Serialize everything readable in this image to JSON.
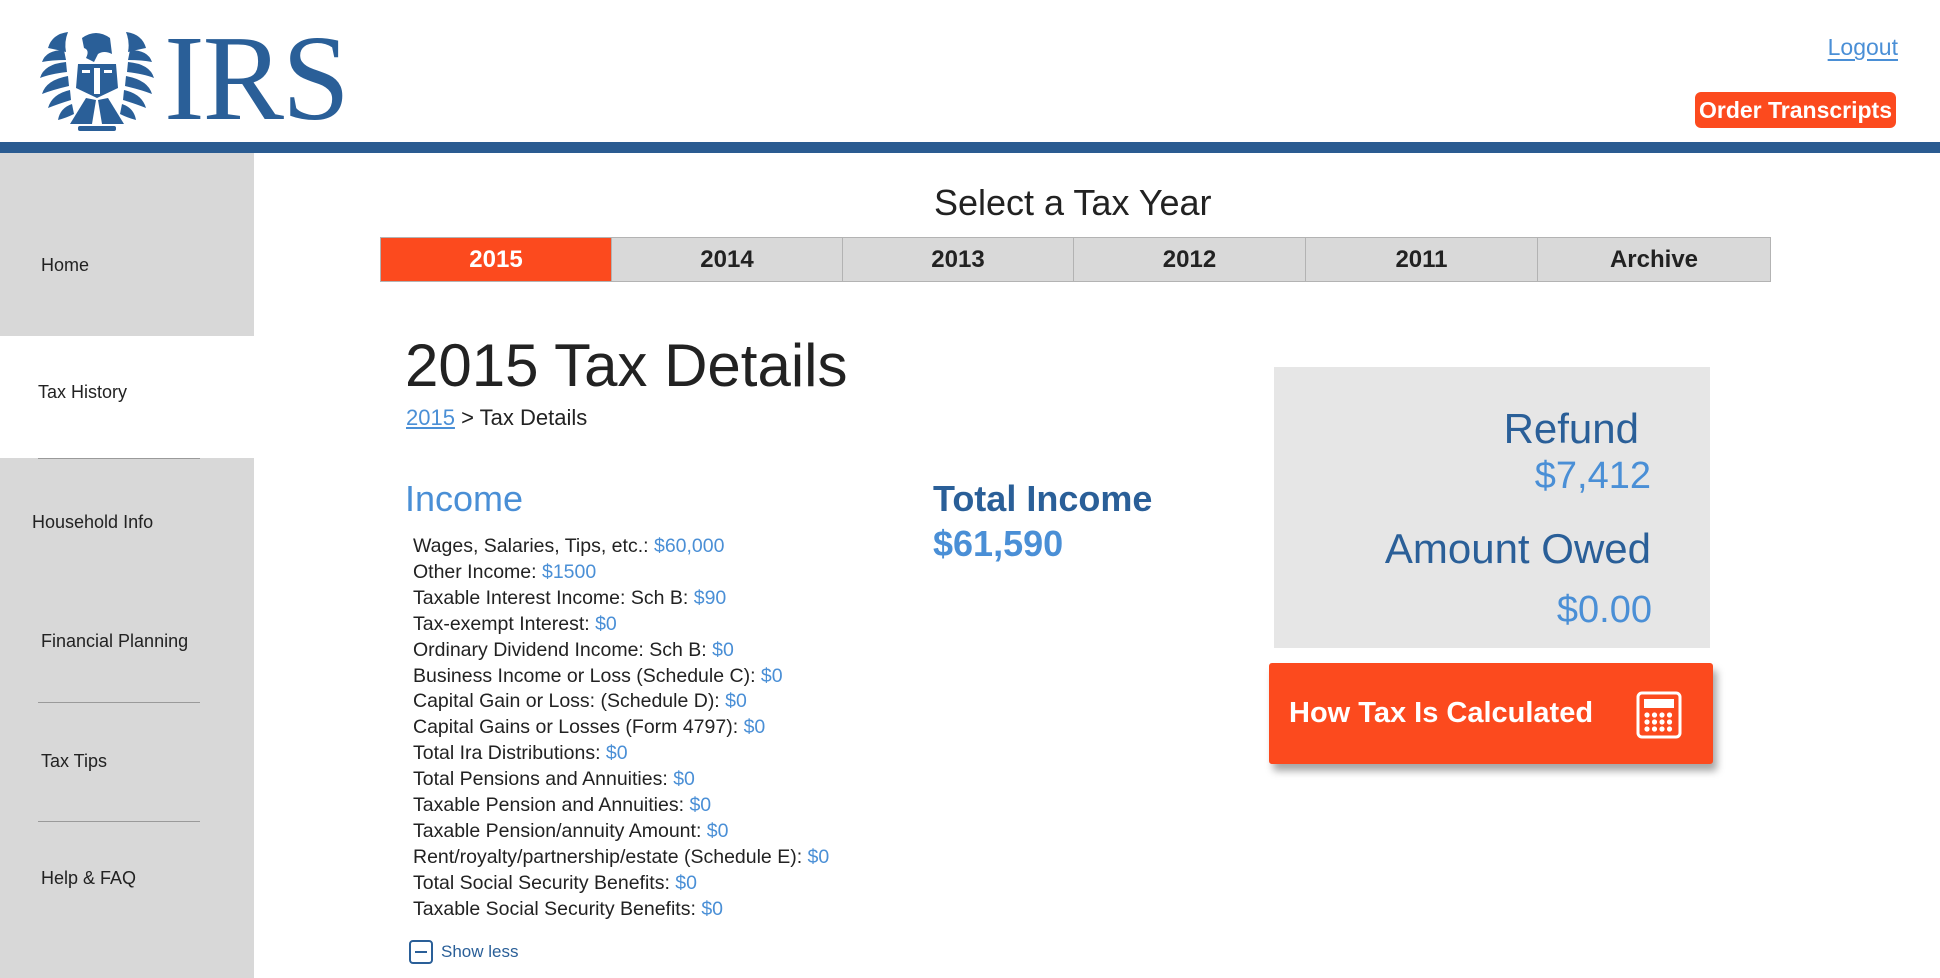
{
  "header": {
    "logo_text": "IRS",
    "logout_label": "Logout",
    "order_label": "Order Transcripts",
    "accent_color": "#fc4a1e",
    "brand_color": "#2a5b91"
  },
  "sidebar": {
    "items": [
      {
        "label": "Home",
        "active": false
      },
      {
        "label": "Tax History",
        "active": true
      },
      {
        "label": "Household Info",
        "active": false
      },
      {
        "label": "Financial Planning",
        "active": false
      },
      {
        "label": "Tax Tips",
        "active": false
      },
      {
        "label": "Help & FAQ",
        "active": false
      }
    ]
  },
  "year_select": {
    "title": "Select a Tax Year",
    "tabs": [
      {
        "label": "2015",
        "active": true
      },
      {
        "label": "2014",
        "active": false
      },
      {
        "label": "2013",
        "active": false
      },
      {
        "label": "2012",
        "active": false
      },
      {
        "label": "2011",
        "active": false
      },
      {
        "label": "Archive",
        "active": false
      }
    ]
  },
  "main": {
    "title": "2015 Tax Details",
    "breadcrumb": {
      "link": "2015",
      "separator": ">",
      "current": "Tax Details"
    },
    "income": {
      "heading": "Income",
      "rows": [
        {
          "label": "Wages, Salaries, Tips, etc.:",
          "value": "$60,000"
        },
        {
          "label": "Other Income:",
          "value": "$1500"
        },
        {
          "label": "Taxable Interest Income: Sch B:",
          "value": "$90"
        },
        {
          "label": "Tax-exempt Interest:",
          "value": "$0"
        },
        {
          "label": "Ordinary Dividend Income: Sch B:",
          "value": "$0"
        },
        {
          "label": "Business Income or Loss (Schedule C):",
          "value": "$0"
        },
        {
          "label": "Capital Gain or Loss: (Schedule D):",
          "value": "$0"
        },
        {
          "label": "Capital Gains or Losses (Form 4797):",
          "value": "$0"
        },
        {
          "label": "Total Ira Distributions:",
          "value": "$0"
        },
        {
          "label": "Total Pensions and Annuities:",
          "value": "$0"
        },
        {
          "label": "Taxable Pension and Annuities:",
          "value": "$0"
        },
        {
          "label": "Taxable Pension/annuity Amount:",
          "value": "$0"
        },
        {
          "label": "Rent/royalty/partnership/estate (Schedule E):",
          "value": "$0"
        },
        {
          "label": "Total Social Security Benefits:",
          "value": "$0"
        },
        {
          "label": "Taxable Social Security Benefits:",
          "value": "$0"
        }
      ],
      "show_less": "Show less"
    },
    "total_income": {
      "label": "Total Income",
      "value": "$61,590"
    },
    "summary": {
      "refund_label": "Refund",
      "refund_value": "$7,412",
      "owed_label": "Amount Owed",
      "owed_value": "$0.00"
    },
    "calc_button": {
      "label": "How Tax Is Calculated",
      "icon": "calculator-icon"
    }
  }
}
